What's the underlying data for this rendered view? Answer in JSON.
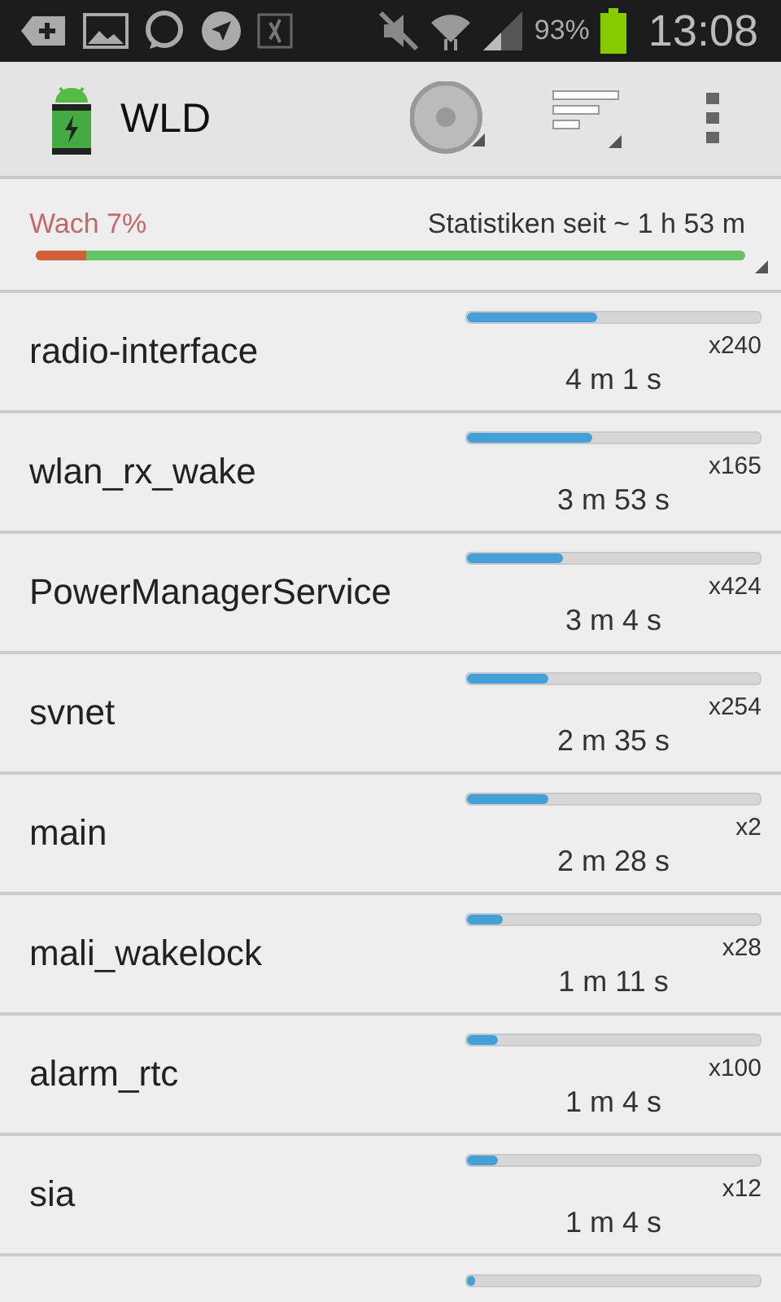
{
  "status_bar": {
    "battery_text": "93%",
    "time": "13:08"
  },
  "action_bar": {
    "title": "WLD"
  },
  "summary": {
    "awake": "Wach 7%",
    "since": "Statistiken seit ~ 1 h 53 m",
    "level": 0.07
  },
  "wakelocks": [
    {
      "name": "radio-interface",
      "level": 0.445,
      "count": "x240",
      "duration": "4 m 1 s"
    },
    {
      "name": "wlan_rx_wake",
      "level": 0.43,
      "count": "x165",
      "duration": "3 m 53 s"
    },
    {
      "name": "PowerManagerService",
      "level": 0.33,
      "count": "x424",
      "duration": "3 m 4 s"
    },
    {
      "name": "svnet",
      "level": 0.28,
      "count": "x254",
      "duration": "2 m 35 s"
    },
    {
      "name": "main",
      "level": 0.275,
      "count": "x2",
      "duration": "2 m 28 s"
    },
    {
      "name": "mali_wakelock",
      "level": 0.12,
      "count": "x28",
      "duration": "1 m 11 s"
    },
    {
      "name": "alarm_rtc",
      "level": 0.105,
      "count": "x100",
      "duration": "1 m 4 s"
    },
    {
      "name": "sia",
      "level": 0.105,
      "count": "x12",
      "duration": "1 m 4 s"
    },
    {
      "level": 0.03
    }
  ]
}
